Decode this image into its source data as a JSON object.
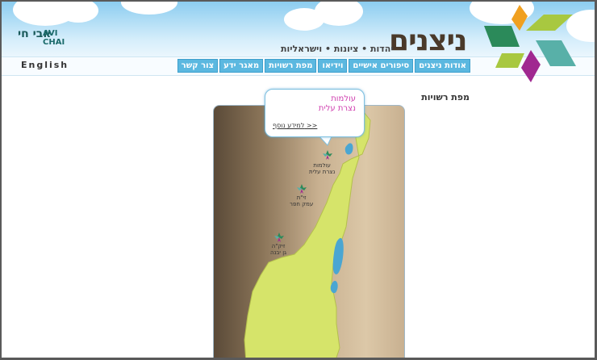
{
  "header": {
    "site_title": "ניצנים",
    "tagline": "יהדות • ציונות • וישראליות",
    "partner_logo": {
      "hebrew": "אבי חי",
      "english_line1": "AVI",
      "english_line2": "CHAI"
    }
  },
  "nav": {
    "items": [
      {
        "label": "אודות ניצנים"
      },
      {
        "label": "סיפורים אישיים"
      },
      {
        "label": "וידיאו"
      },
      {
        "label": "מפת רשויות"
      },
      {
        "label": "מאגר ידע"
      },
      {
        "label": "צור קשר"
      }
    ],
    "language_link": "English"
  },
  "main": {
    "page_title": "מפת רשויות",
    "popup": {
      "line1": "עולמות",
      "line2": "נצרת עלית",
      "more_link": "למידע נוסף >>"
    },
    "sites": [
      {
        "line1": "עולמות",
        "line2": "נצרת עלית"
      },
      {
        "line1": "זי\"ת",
        "line2": "עמק חפר"
      },
      {
        "line1": "זיק\"ה",
        "line2": "גן יבנה"
      }
    ]
  },
  "colors": {
    "nav_button": "#5bb8e0",
    "map_land": "#d6e46a",
    "water": "#4aa6d2",
    "popup_text": "#d040b0",
    "logo_green": "#2b8a5a",
    "logo_orange": "#f0a020",
    "logo_lime": "#a8c840",
    "logo_purple": "#a02890",
    "logo_teal": "#58b0a8"
  },
  "icons": {
    "site_marker": "leaf-flower-icon"
  }
}
